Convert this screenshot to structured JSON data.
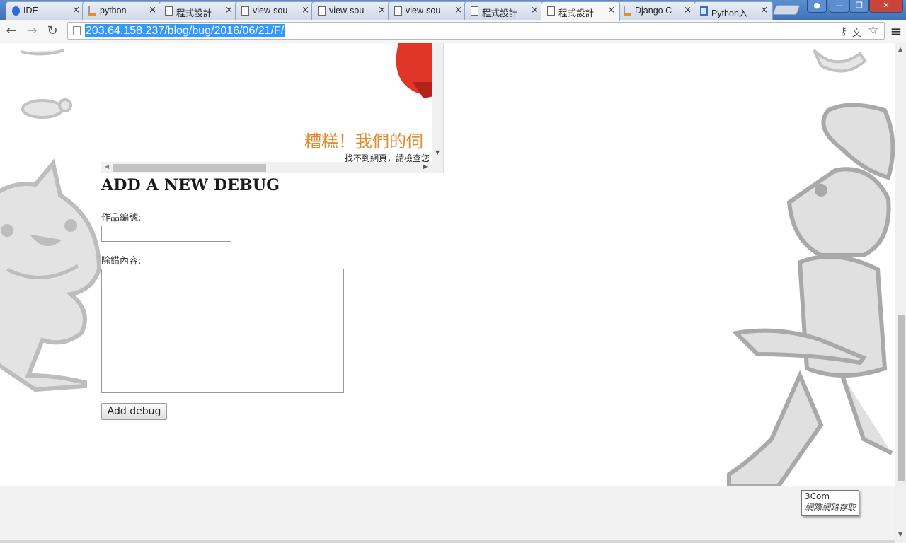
{
  "window": {
    "tabs": [
      {
        "title": "IDE",
        "icon": "code-icon",
        "active": false
      },
      {
        "title": "python -",
        "icon": "stackoverflow-icon",
        "active": false
      },
      {
        "title": "程式設計",
        "icon": "page-icon",
        "active": false
      },
      {
        "title": "view-sou",
        "icon": "page-icon",
        "active": false
      },
      {
        "title": "view-sou",
        "icon": "page-icon",
        "active": false
      },
      {
        "title": "view-sou",
        "icon": "page-icon",
        "active": false
      },
      {
        "title": "程式設計",
        "icon": "page-icon",
        "active": false
      },
      {
        "title": "程式設計",
        "icon": "page-icon",
        "active": true
      },
      {
        "title": "Django C",
        "icon": "stackoverflow-icon",
        "active": false
      },
      {
        "title": "Python入",
        "icon": "window-icon",
        "active": false
      }
    ],
    "tab_close_glyph": "×"
  },
  "toolbar": {
    "back_glyph": "←",
    "forward_glyph": "→",
    "reload_glyph": "↻",
    "url": "203.64.158.237/blog/bug/2016/06/21/F/",
    "key_glyph": "⚷",
    "translate_glyph": "文",
    "star_glyph": "☆",
    "menu_glyph": "≡"
  },
  "embed": {
    "heading": "糟糕！我們的伺",
    "subtext": "找不到網頁，請檢查您"
  },
  "form": {
    "title": "ADD A NEW DEBUG",
    "id_label": "作品編號:",
    "content_label": "除錯內容:",
    "id_value": "",
    "content_value": "",
    "submit_label": "Add debug"
  },
  "tooltip": {
    "title": "3Com",
    "subtitle": "網際網路存取"
  },
  "colors": {
    "titlebar": "#4a7fc1",
    "url_highlight": "#3399ff",
    "embed_heading": "#e08a2e"
  }
}
